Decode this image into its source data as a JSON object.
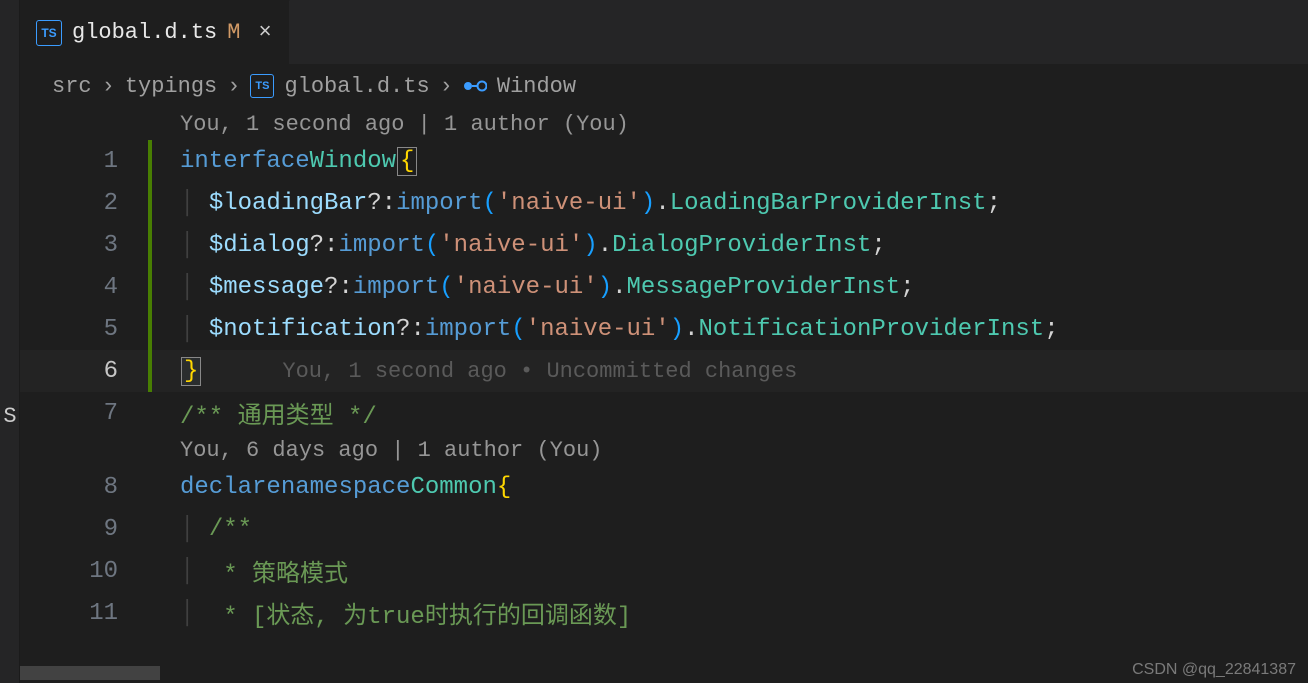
{
  "left_stub": {
    "letter": "S"
  },
  "tab": {
    "filename": "global.d.ts",
    "modified_indicator": "M",
    "close_glyph": "×",
    "ts_badge": "TS"
  },
  "breadcrumbs": {
    "parts": [
      "src",
      "typings",
      "global.d.ts",
      "Window"
    ],
    "sep": "›",
    "ts_badge": "TS"
  },
  "codelens": {
    "blame1": "You, 1 second ago | 1 author (You)",
    "blame2": "You, 6 days ago | 1 author (You)",
    "inline_blame": "You, 1 second ago • Uncommitted changes"
  },
  "lines": {
    "n1": "1",
    "n2": "2",
    "n3": "3",
    "n4": "4",
    "n5": "5",
    "n6": "6",
    "n7": "7",
    "n8": "8",
    "n9": "9",
    "n10": "10",
    "n11": "11"
  },
  "code": {
    "l1": {
      "kw1": "interface",
      "type": "Window",
      "brace": "{"
    },
    "l2": {
      "prop": "$loadingBar",
      "opt": "?",
      "colon": ":",
      "kw": "import",
      "str": "'naive-ui'",
      "member": "LoadingBarProviderInst"
    },
    "l3": {
      "prop": "$dialog",
      "opt": "?",
      "colon": ":",
      "kw": "import",
      "str": "'naive-ui'",
      "member": "DialogProviderInst"
    },
    "l4": {
      "prop": "$message",
      "opt": "?",
      "colon": ":",
      "kw": "import",
      "str": "'naive-ui'",
      "member": "MessageProviderInst"
    },
    "l5": {
      "prop": "$notification",
      "opt": "?",
      "colon": ":",
      "kw": "import",
      "str": "'naive-ui'",
      "member": "NotificationProviderInst"
    },
    "l6": {
      "brace": "}"
    },
    "l7": {
      "comment": "/** 通用类型 */"
    },
    "l8": {
      "kw1": "declare",
      "kw2": "namespace",
      "type": "Common",
      "brace": "{"
    },
    "l9": {
      "comment": "/**"
    },
    "l10": {
      "comment": " * 策略模式"
    },
    "l11": {
      "comment": " * [状态, 为true时执行的回调函数]"
    }
  },
  "watermark": "CSDN @qq_22841387"
}
